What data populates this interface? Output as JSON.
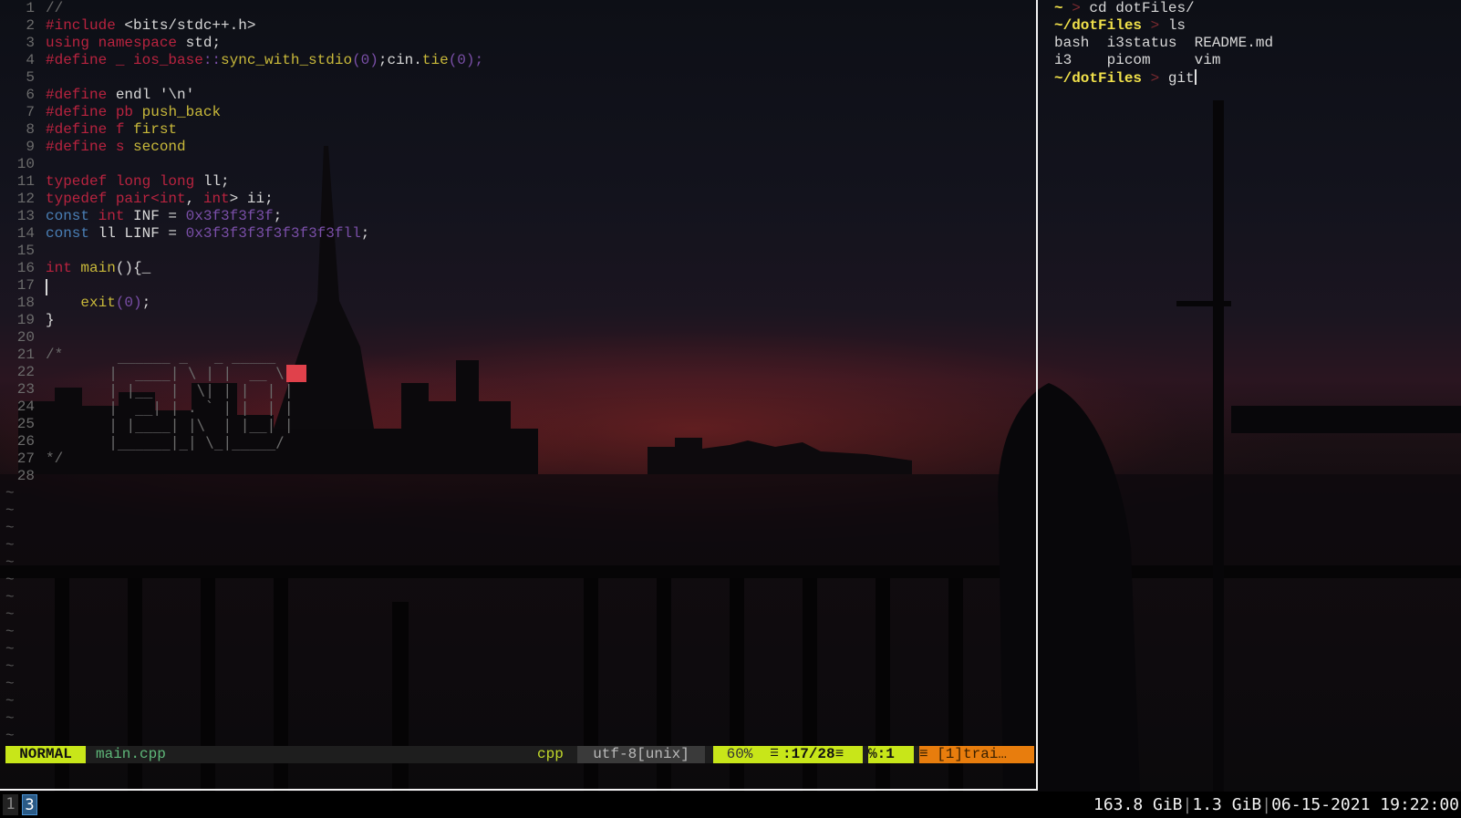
{
  "vim": {
    "line_numbers": [
      "1",
      "2",
      "3",
      "4",
      "5",
      "6",
      "7",
      "8",
      "9",
      "10",
      "11",
      "12",
      "13",
      "14",
      "15",
      "16",
      "17",
      "18",
      "19",
      "20",
      "21",
      "22",
      "23",
      "24",
      "25",
      "26",
      "27",
      "28"
    ],
    "code": {
      "l1": "//",
      "l2_a": "#include",
      "l2_b": " <bits/stdc++.h>",
      "l3_a": "using namespace",
      "l3_b": " std;",
      "l4_a": "#define _ ",
      "l4_b": "ios_base",
      "l4_c": "::",
      "l4_d": "sync_with_stdio",
      "l4_e": "(0)",
      "l4_f": ";cin.",
      "l4_g": "tie",
      "l4_h": "(0);",
      "l6_a": "#define",
      "l6_b": " endl '\\n'",
      "l7_a": "#define",
      "l7_b": " pb",
      "l7_c": " push_back",
      "l8_a": "#define",
      "l8_b": " f",
      "l8_c": " first",
      "l9_a": "#define",
      "l9_b": " s",
      "l9_c": " second",
      "l11_a": "typedef long long",
      "l11_b": " ll;",
      "l12_a": "typedef pair<",
      "l12_b": "int",
      "l12_c": ", ",
      "l12_d": "int",
      "l12_e": "> ii;",
      "l13_a": "const",
      "l13_b": " int",
      "l13_c": " INF = ",
      "l13_d": "0x3f3f3f3f",
      "l13_e": ";",
      "l14_a": "const",
      "l14_b": " ll LINF = ",
      "l14_c": "0x3f3f3f3f3f3f3f3fll",
      "l14_d": ";",
      "l16_a": "int",
      "l16_b": " main",
      "l16_c": "(){_",
      "l18_a": "    exit",
      "l18_b": "(0)",
      "l18_c": ";",
      "l19": "}",
      "l21": "/*",
      "l27": "*/"
    },
    "ascii_art": "   ______ _   _ _____\n  |  ____| \\ | |  __ \\\n  | |__  |  \\| | |  | |\n  |  __| | . ` | |  | |\n  | |____| |\\  | |__| |\n  |______|_| \\_|_____/",
    "tilde": "~",
    "statusline": {
      "mode": "NORMAL",
      "filename": "main.cpp",
      "filetype": "cpp",
      "encoding": "utf-8[unix]",
      "percent": "60%",
      "line_icon": "☰",
      "position": ":17/28≡",
      "column": "℅:1",
      "warning": "≡ [1]trai…"
    }
  },
  "terminal": {
    "line1_prompt": "~",
    "line1_arrow": " > ",
    "line1_cmd": "cd dotFiles/",
    "line2_prompt": "~/dotFiles",
    "line2_arrow": " > ",
    "line2_cmd": "ls",
    "ls_row1": "bash  i3status  README.md",
    "ls_row2": "i3    picom     vim",
    "line5_prompt": "~/dotFiles",
    "line5_arrow": " > ",
    "line5_cmd": "git"
  },
  "i3bar": {
    "workspaces": [
      "1",
      "3"
    ],
    "active_workspace": "3",
    "disk": "163.8 GiB",
    "memory": "1.3 GiB",
    "date": "06-15-2021",
    "time": "19:22:00"
  }
}
